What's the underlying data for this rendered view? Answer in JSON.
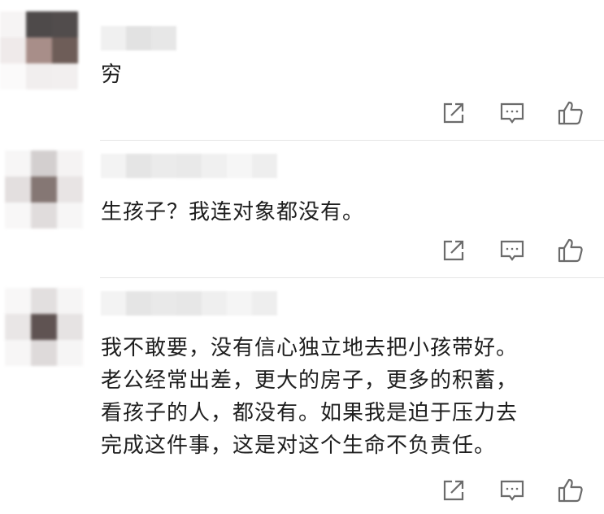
{
  "comments": [
    {
      "text_lines": [
        "穷"
      ],
      "actions": {
        "share_icon": "share-icon",
        "reply_icon": "reply-icon",
        "like_icon": "thumbs-up-icon"
      }
    },
    {
      "text_lines": [
        "生孩子？我连对象都没有。"
      ],
      "actions": {
        "share_icon": "share-icon",
        "reply_icon": "reply-icon",
        "like_icon": "thumbs-up-icon"
      }
    },
    {
      "text_lines": [
        "我不敢要，没有信心独立地去把小孩带好。",
        "老公经常出差，更大的房子，更多的积蓄，",
        "看孩子的人，都没有。如果我是迫于压力去",
        "完成这件事，这是对这个生命不负责任。"
      ],
      "actions": {
        "share_icon": "share-icon",
        "reply_icon": "reply-icon",
        "like_icon": "thumbs-up-icon"
      }
    }
  ],
  "colors": {
    "text": "#1e1e1e",
    "icon": "#6b6b6b",
    "divider": "#e6e6e6"
  }
}
